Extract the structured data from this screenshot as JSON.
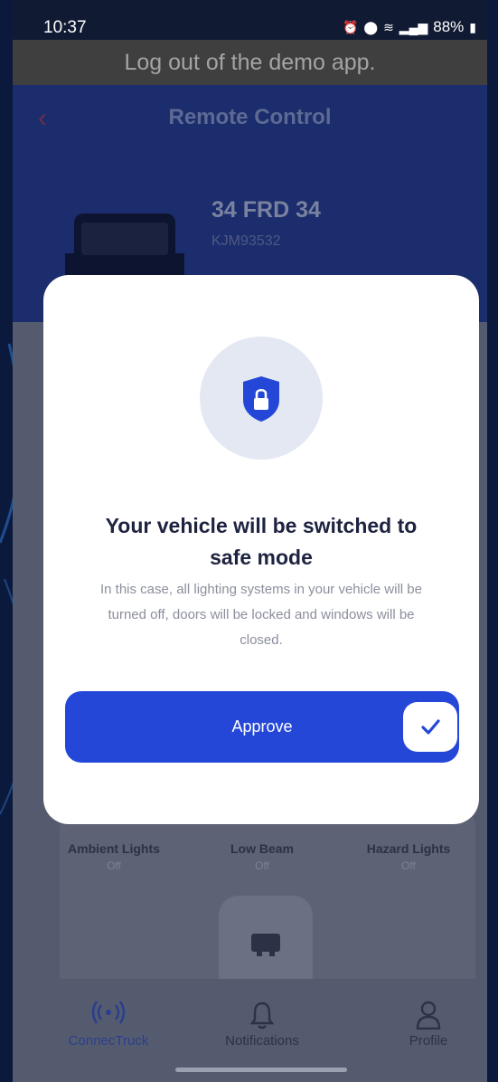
{
  "status_bar": {
    "time": "10:37",
    "battery": "88%"
  },
  "banner": {
    "text": "Log out of the demo app."
  },
  "header": {
    "title": "Remote Control",
    "plate": "34 FRD 34",
    "vin": "KJM93532"
  },
  "lights": [
    {
      "name": "Ambient Lights",
      "state": "Off"
    },
    {
      "name": "Low Beam",
      "state": "Off"
    },
    {
      "name": "Hazard Lights",
      "state": "Off"
    }
  ],
  "modal": {
    "icon": "shield-lock-icon",
    "title_line1": "Your vehicle will be switched to",
    "title_line2": "safe mode",
    "description_line1": "In this case, all lighting systems in your vehicle will be",
    "description_line2": "turned off, doors will be locked and windows will be",
    "description_line3": "closed.",
    "approve_label": "Approve"
  },
  "bottom_nav": [
    {
      "label": "ConnecTruck",
      "icon": "broadcast-icon",
      "active": true
    },
    {
      "label": "Notifications",
      "icon": "bell-icon",
      "active": false
    },
    {
      "label": "Profile",
      "icon": "person-icon",
      "active": false
    }
  ],
  "colors": {
    "accent": "#2447d8",
    "modal_bg": "#ffffff",
    "title_text": "#1d2340",
    "desc_text": "#8b8f9c"
  }
}
